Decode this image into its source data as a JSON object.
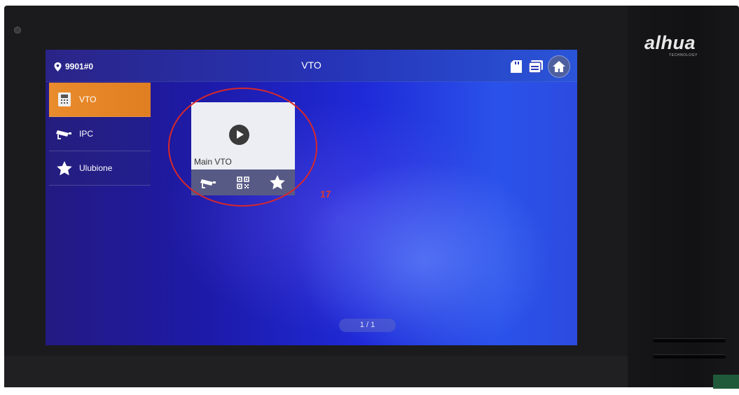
{
  "device": {
    "brand": "alhua",
    "brand_sub": "TECHNOLOGY"
  },
  "header": {
    "location": "9901#0",
    "title": "VTO",
    "icons": [
      "sd-card-icon",
      "storage-icon",
      "home-icon"
    ]
  },
  "sidebar": {
    "items": [
      {
        "label": "VTO",
        "icon": "door-station-icon",
        "active": true
      },
      {
        "label": "IPC",
        "icon": "camera-icon",
        "active": false
      },
      {
        "label": "Ulubione",
        "icon": "star-icon",
        "active": false
      }
    ]
  },
  "card": {
    "name": "Main VTO",
    "actions": [
      "camera-icon",
      "qr-code-icon",
      "star-icon"
    ]
  },
  "pager": "1 / 1",
  "annotation": {
    "number": "17",
    "color": "#d6282a"
  },
  "colors": {
    "active_tab": "#e98c2c",
    "screen_blue": "#1f2ad8"
  }
}
